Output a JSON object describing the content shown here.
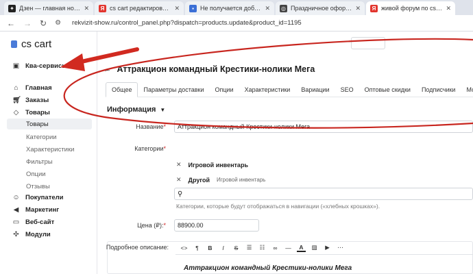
{
  "browser": {
    "tabs": [
      {
        "title": "Дзен — главная новостная ин",
        "fav_color": "#222222",
        "fav_glyph": "✦",
        "active": false
      },
      {
        "title": "cs cart редактирование produ",
        "fav_color": "#e2352e",
        "fav_glyph": "Я",
        "active": false
      },
      {
        "title": "Не получается добавить вклад",
        "fav_color": "#3b6fd6",
        "fav_glyph": "▪",
        "active": false
      },
      {
        "title": "Праздничное оформление гос",
        "fav_color": "#444444",
        "fav_glyph": "◎",
        "active": false
      },
      {
        "title": "живой форум по cs cart — Ян",
        "fav_color": "#e2352e",
        "fav_glyph": "Я",
        "active": true
      }
    ],
    "url": "rekvizit-show.ru/control_panel.php?dispatch=products.update&product_id=1195"
  },
  "sidebar": {
    "logo": "cs cart",
    "service": "Ква-сервисы",
    "items": [
      {
        "label": "Главная",
        "icon": "home-icon"
      },
      {
        "label": "Заказы",
        "icon": "cart-icon"
      },
      {
        "label": "Товары",
        "icon": "tag-icon"
      }
    ],
    "sub": [
      {
        "label": "Товары",
        "active": true
      },
      {
        "label": "Категории"
      },
      {
        "label": "Характеристики"
      },
      {
        "label": "Фильтры"
      },
      {
        "label": "Опции"
      },
      {
        "label": "Отзывы"
      }
    ],
    "items2": [
      {
        "label": "Покупатели",
        "icon": "users-icon"
      },
      {
        "label": "Маркетинг",
        "icon": "megaphone-icon"
      },
      {
        "label": "Веб-сайт",
        "icon": "monitor-icon"
      },
      {
        "label": "Модули",
        "icon": "puzzle-icon"
      }
    ]
  },
  "page": {
    "title": "Аттракцион командный Крестики-нолики Мега",
    "tabs": [
      "Общее",
      "Параметры доставки",
      "Опции",
      "Характеристики",
      "Вариации",
      "SEO",
      "Оптовые скидки",
      "Подписчики",
      "Модули"
    ],
    "section": "Информация",
    "name_label": "Название",
    "name_value": "Аттракцион командный Крестики-нолики Мега",
    "categories_label": "Категории",
    "categories": [
      {
        "name": "Игровой инвентарь",
        "path": ""
      },
      {
        "name": "Другой",
        "path": "Игровой инвентарь"
      }
    ],
    "categories_hint": "Категории, которые будут отображаться в навигации («хлебных крошках»).",
    "price_label": "Цена (₽):",
    "price_value": "88900.00",
    "desc_label": "Подробное описание:",
    "desc_text": "Аттракцион командный Крестики-нолики Мега"
  },
  "annotation": {
    "arrow_color": "#d12a20",
    "ellipse_color": "#c8261f"
  }
}
